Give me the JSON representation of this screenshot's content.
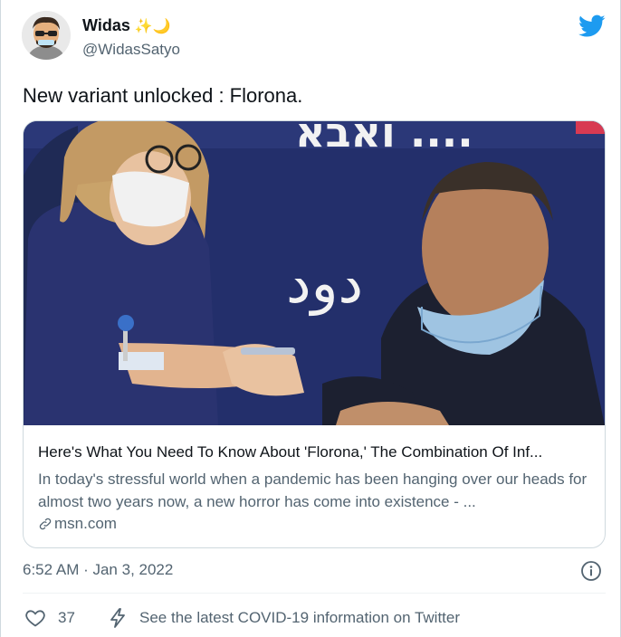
{
  "author": {
    "display_name": "Widas",
    "name_emoji": "✨🌙",
    "handle": "@WidasSatyo"
  },
  "tweet": {
    "text": "New variant unlocked : Florona."
  },
  "link_card": {
    "title": "Here's What You Need To Know About 'Florona,' The Combination Of Inf...",
    "description": "In today's stressful world when a pandemic has been hanging over our heads for almost two years now, a new horror has come into existence - ...",
    "domain": "msn.com",
    "image_text": {
      "banner_top": "ואבא ....",
      "banner_arabic": "دود"
    }
  },
  "meta": {
    "timestamp": "6:52 AM · Jan 3, 2022"
  },
  "actions": {
    "like_count": "37",
    "covid_link": "See the latest COVID-19 information on Twitter"
  },
  "colors": {
    "twitter_blue": "#1d9bf0",
    "secondary_text": "#536471",
    "banner_navy": "#232f6b"
  },
  "icons": {
    "brand": "twitter-bird-icon",
    "info": "info-icon",
    "like": "heart-icon",
    "covid": "lightning-bolt-icon",
    "link": "link-chain-icon"
  }
}
